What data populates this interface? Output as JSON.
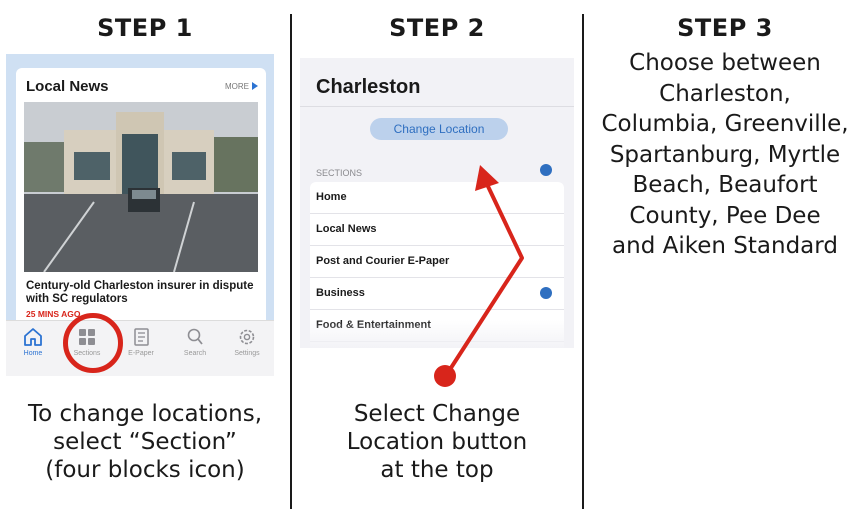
{
  "steps": [
    {
      "title": "STEP 1",
      "caption": [
        "To change locations,",
        "select “Section”",
        "(four blocks icon)"
      ]
    },
    {
      "title": "STEP 2",
      "caption": [
        "Select Change",
        "Location button",
        "at the top"
      ]
    },
    {
      "title": "STEP 3",
      "body": [
        "Choose between",
        "Charleston,",
        "Columbia, Greenville,",
        "Spartanburg, Myrtle",
        "Beach, Beaufort",
        "County, Pee Dee",
        "and Aiken Standard"
      ]
    }
  ],
  "phone1": {
    "section_title": "Local News",
    "more_label": "MORE",
    "headline": "Century-old Charleston insurer in dispute with SC regulators",
    "time_ago": "25 MINS AGO",
    "tabs": [
      {
        "label": "Home",
        "icon": "home-icon"
      },
      {
        "label": "Sections",
        "icon": "four-blocks-icon"
      },
      {
        "label": "E-Paper",
        "icon": "newspaper-icon"
      },
      {
        "label": "Search",
        "icon": "search-icon"
      },
      {
        "label": "Settings",
        "icon": "gear-icon"
      }
    ],
    "active_tab": "Home"
  },
  "phone2": {
    "city_title": "Charleston",
    "change_location_label": "Change Location",
    "sections_label": "SECTIONS",
    "items": [
      "Home",
      "Local News",
      "Post and Courier E-Paper",
      "Business",
      "Food & Entertainment"
    ]
  },
  "colors": {
    "accent_blue": "#2f6fc0",
    "highlight_red": "#d8251b"
  }
}
